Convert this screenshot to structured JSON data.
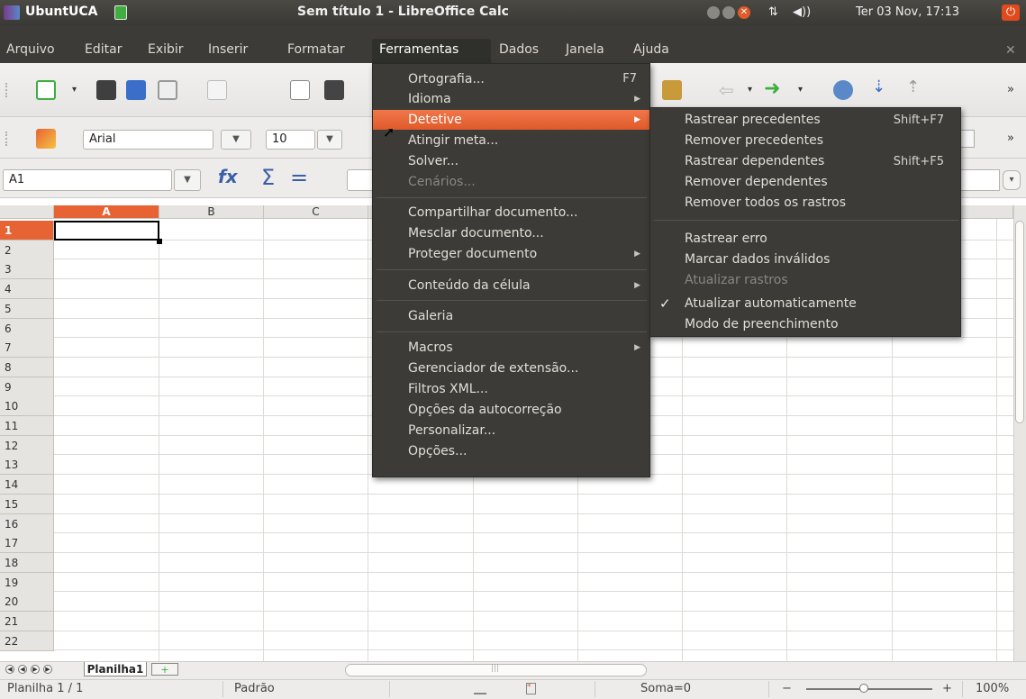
{
  "panel": {
    "app_name": "UbuntUCA",
    "window_title": "Sem título 1 - LibreOffice Calc",
    "clock": "Ter 03 Nov, 17:13",
    "net": "⇅",
    "volume": "◀))"
  },
  "menubar": {
    "items": [
      "Arquivo",
      "Editar",
      "Exibir",
      "Inserir",
      "Formatar",
      "Ferramentas",
      "Dados",
      "Janela",
      "Ajuda"
    ],
    "close": "✕"
  },
  "formatting": {
    "font_name": "Arial",
    "font_size": "10"
  },
  "formula_bar": {
    "cell_ref": "A1",
    "fx": "fx",
    "sum": "Σ",
    "equals": "="
  },
  "grid": {
    "columns": [
      "A",
      "B",
      "C"
    ],
    "rows": [
      "1",
      "2",
      "3",
      "4",
      "5",
      "6",
      "7",
      "8",
      "9",
      "10",
      "11",
      "12",
      "13",
      "14",
      "15",
      "16",
      "17",
      "18",
      "19",
      "20",
      "21",
      "22"
    ]
  },
  "ferramentas_menu": {
    "items": [
      {
        "label": "Ortografia...",
        "accel": "F7"
      },
      {
        "label": "Idioma",
        "submenu": true
      },
      {
        "label": "Detetive",
        "submenu": true,
        "highlighted": true
      },
      {
        "label": "Atingir meta..."
      },
      {
        "label": "Solver..."
      },
      {
        "label": "Cenários...",
        "disabled": true
      },
      {
        "label": "Compartilhar documento..."
      },
      {
        "label": "Mesclar documento..."
      },
      {
        "label": "Proteger documento",
        "submenu": true
      },
      {
        "label": "Conteúdo da célula",
        "submenu": true
      },
      {
        "label": "Galeria"
      },
      {
        "label": "Macros",
        "submenu": true
      },
      {
        "label": "Gerenciador de extensão..."
      },
      {
        "label": "Filtros XML..."
      },
      {
        "label": "Opções da autocorreção"
      },
      {
        "label": "Personalizar..."
      },
      {
        "label": "Opções..."
      }
    ]
  },
  "detetive_menu": {
    "items": [
      {
        "label": "Rastrear precedentes",
        "accel": "Shift+F7"
      },
      {
        "label": "Remover precedentes"
      },
      {
        "label": "Rastrear dependentes",
        "accel": "Shift+F5"
      },
      {
        "label": "Remover dependentes"
      },
      {
        "label": "Remover todos os rastros"
      },
      {
        "label": "Rastrear erro"
      },
      {
        "label": "Marcar dados inválidos"
      },
      {
        "label": "Atualizar rastros",
        "disabled": true
      },
      {
        "label": "Atualizar automaticamente",
        "checked": true
      },
      {
        "label": "Modo de preenchimento"
      }
    ]
  },
  "sheet_tabs": {
    "active": "Planilha1",
    "add": "+"
  },
  "status": {
    "sheet": "Planilha 1 / 1",
    "style": "Padrão",
    "sum": "Soma=0",
    "zoom_minus": "−",
    "zoom_plus": "+",
    "zoom": "100%"
  },
  "colors": {
    "menu_bg": "#3c3b37",
    "highlight": "#e86334",
    "panel_bg": "#3c3b37"
  }
}
